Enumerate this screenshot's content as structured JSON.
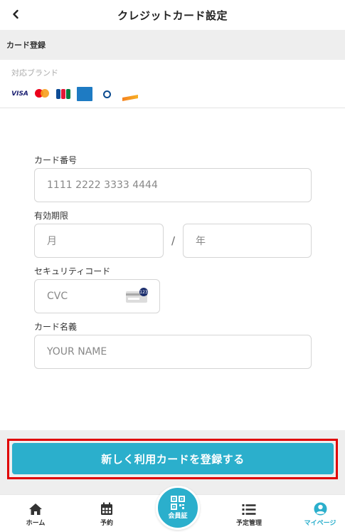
{
  "header": {
    "title": "クレジットカード設定",
    "back_icon": "chevron-left-icon"
  },
  "section": {
    "title": "カード登録"
  },
  "brands": {
    "label": "対応ブランド",
    "items": [
      {
        "name": "VISA",
        "icon": "visa-logo"
      },
      {
        "name": "Mastercard",
        "icon": "mastercard-logo"
      },
      {
        "name": "JCB",
        "icon": "jcb-logo"
      },
      {
        "name": "AMERICAN EXPRESS",
        "icon": "amex-logo"
      },
      {
        "name": "Diners Club",
        "icon": "diners-logo"
      },
      {
        "name": "DISCOVER",
        "icon": "discover-logo"
      }
    ]
  },
  "form": {
    "card_number": {
      "label": "カード番号",
      "placeholder": "1111 2222 3333 4444"
    },
    "expiry": {
      "label": "有効期限",
      "month_placeholder": "月",
      "separator": "/",
      "year_placeholder": "年"
    },
    "cvc": {
      "label": "セキュリティコード",
      "placeholder": "CVC",
      "hint_badge": "123"
    },
    "name": {
      "label": "カード名義",
      "placeholder": "YOUR NAME"
    }
  },
  "submit": {
    "label": "新しく利用カードを登録する"
  },
  "nav": {
    "items": [
      {
        "label": "ホーム",
        "icon": "home-icon"
      },
      {
        "label": "予約",
        "icon": "calendar-icon"
      },
      {
        "label": "会員証",
        "icon": "qr-code-icon"
      },
      {
        "label": "予定管理",
        "icon": "list-icon"
      },
      {
        "label": "マイページ",
        "icon": "user-circle-icon",
        "active": true
      }
    ]
  },
  "colors": {
    "accent": "#2bafcc",
    "highlight": "#e00000",
    "background_gray": "#eeeeee"
  }
}
